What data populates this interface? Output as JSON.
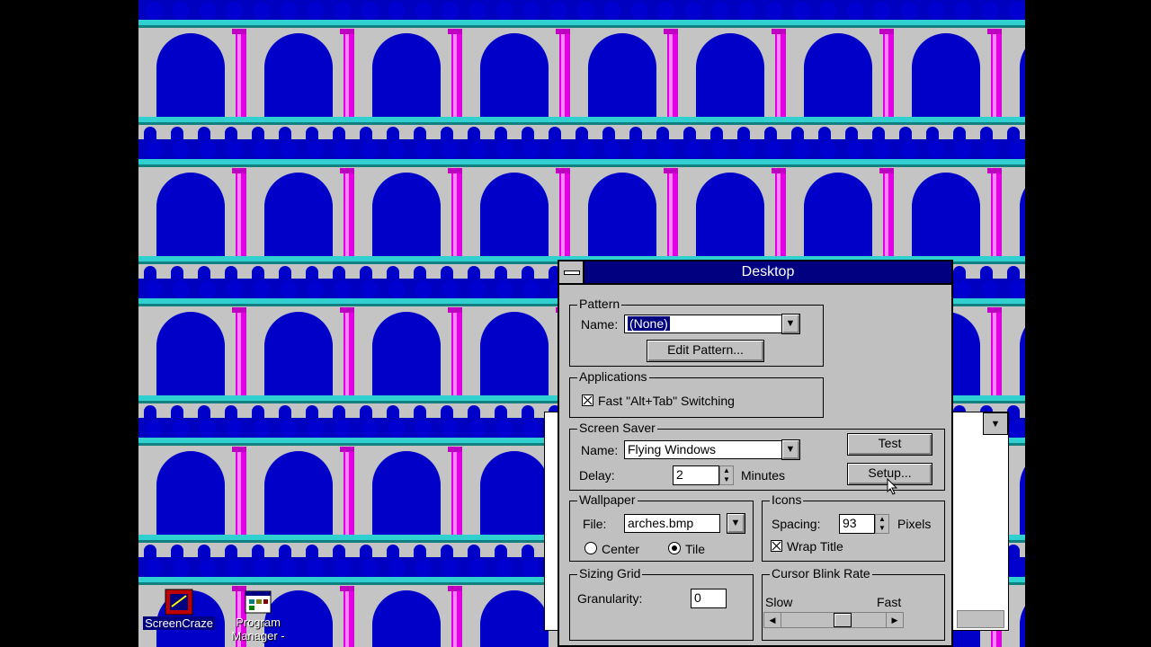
{
  "desktop": {
    "icons": [
      {
        "label": "ScreenCraze",
        "icon": "screencraze-icon"
      },
      {
        "label": "Program Manager -",
        "icon": "program-manager-icon"
      }
    ]
  },
  "dialog": {
    "title": "Desktop",
    "pattern": {
      "group_label": "Pattern",
      "name_label": "Name:",
      "name_value": "(None)",
      "edit_button": "Edit Pattern..."
    },
    "applications": {
      "group_label": "Applications",
      "fast_switch_label": "Fast \"Alt+Tab\" Switching",
      "fast_switch_checked": true
    },
    "screen_saver": {
      "group_label": "Screen Saver",
      "name_label": "Name:",
      "name_value": "Flying Windows",
      "delay_label": "Delay:",
      "delay_value": "2",
      "delay_units": "Minutes",
      "test_button": "Test",
      "setup_button": "Setup..."
    },
    "wallpaper": {
      "group_label": "Wallpaper",
      "file_label": "File:",
      "file_value": "arches.bmp",
      "center_label": "Center",
      "tile_label": "Tile",
      "selected": "Tile"
    },
    "icons": {
      "group_label": "Icons",
      "spacing_label": "Spacing:",
      "spacing_value": "93",
      "spacing_units": "Pixels",
      "wrap_title_label": "Wrap Title",
      "wrap_title_checked": true
    },
    "sizing_grid": {
      "group_label": "Sizing Grid",
      "granularity_label": "Granularity:",
      "granularity_value": "0"
    },
    "cursor_blink": {
      "group_label": "Cursor Blink Rate",
      "slow_label": "Slow",
      "fast_label": "Fast",
      "rate_fraction": 0.6
    }
  },
  "colors": {
    "titlebar": "#000080",
    "dialog_face": "#c0c0c0",
    "arch_sky": "#0000c8",
    "pillar": "#e000e0",
    "ledge": "#20c0c0"
  }
}
